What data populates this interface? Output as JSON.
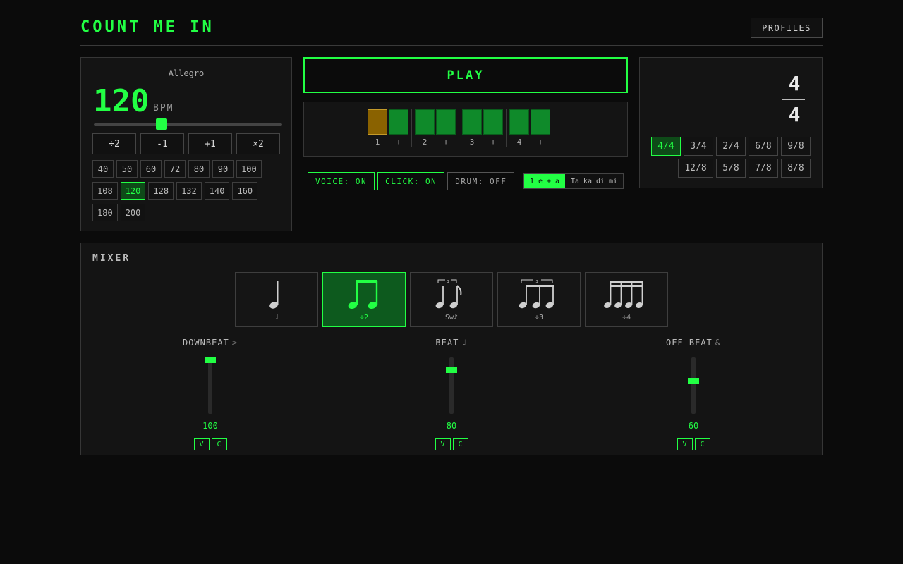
{
  "header": {
    "title": "COUNT ME IN",
    "profiles_label": "PROFILES"
  },
  "tempo": {
    "name": "Allegro",
    "bpm": "120",
    "bpm_unit": "BPM",
    "slider_fraction": 0.36,
    "steps": [
      "÷2",
      "-1",
      "+1",
      "×2"
    ],
    "presets": [
      "40",
      "50",
      "60",
      "72",
      "80",
      "90",
      "100",
      "108",
      "120",
      "128",
      "132",
      "140",
      "160",
      "180",
      "200"
    ],
    "active_preset": "120"
  },
  "transport": {
    "play_label": "PLAY"
  },
  "beats": [
    {
      "labels": [
        "1",
        "+"
      ],
      "current": 0
    },
    {
      "labels": [
        "2",
        "+"
      ],
      "current": -1
    },
    {
      "labels": [
        "3",
        "+"
      ],
      "current": -1
    },
    {
      "labels": [
        "4",
        "+"
      ],
      "current": -1
    }
  ],
  "toggles": {
    "voice": "VOICE: ON",
    "click": "CLICK: ON",
    "drum": "DRUM: OFF"
  },
  "syllables": {
    "on": "1 e + a",
    "off": "Ta ka di mi"
  },
  "time_signature": {
    "numerator": "4",
    "denominator": "4",
    "options": [
      "4/4",
      "3/4",
      "2/4",
      "6/8",
      "9/8",
      "12/8",
      "5/8",
      "7/8",
      "8/8"
    ],
    "active": "4/4"
  },
  "mixer": {
    "title": "MIXER",
    "subdivisions": [
      {
        "label": "♩",
        "icon": "quarter-note-icon"
      },
      {
        "label": "÷2",
        "icon": "eighth-notes-icon"
      },
      {
        "label": "Sw♪",
        "icon": "swing-icon"
      },
      {
        "label": "÷3",
        "icon": "triplet-icon"
      },
      {
        "label": "÷4",
        "icon": "sixteenth-notes-icon"
      }
    ],
    "active_subdivision": 1,
    "channels": [
      {
        "label": "DOWNBEAT",
        "symbol": ">",
        "value": "100",
        "level": 1.0,
        "v": "V",
        "c": "C"
      },
      {
        "label": "BEAT",
        "symbol": "♩",
        "value": "80",
        "level": 0.8,
        "v": "V",
        "c": "C"
      },
      {
        "label": "OFF-BEAT",
        "symbol": "&",
        "value": "60",
        "level": 0.6,
        "v": "V",
        "c": "C"
      }
    ]
  },
  "colors": {
    "accent": "#22ff44",
    "current_beat": "#8a6200",
    "beat": "#0f8a2a",
    "background": "#0b0b0b"
  }
}
